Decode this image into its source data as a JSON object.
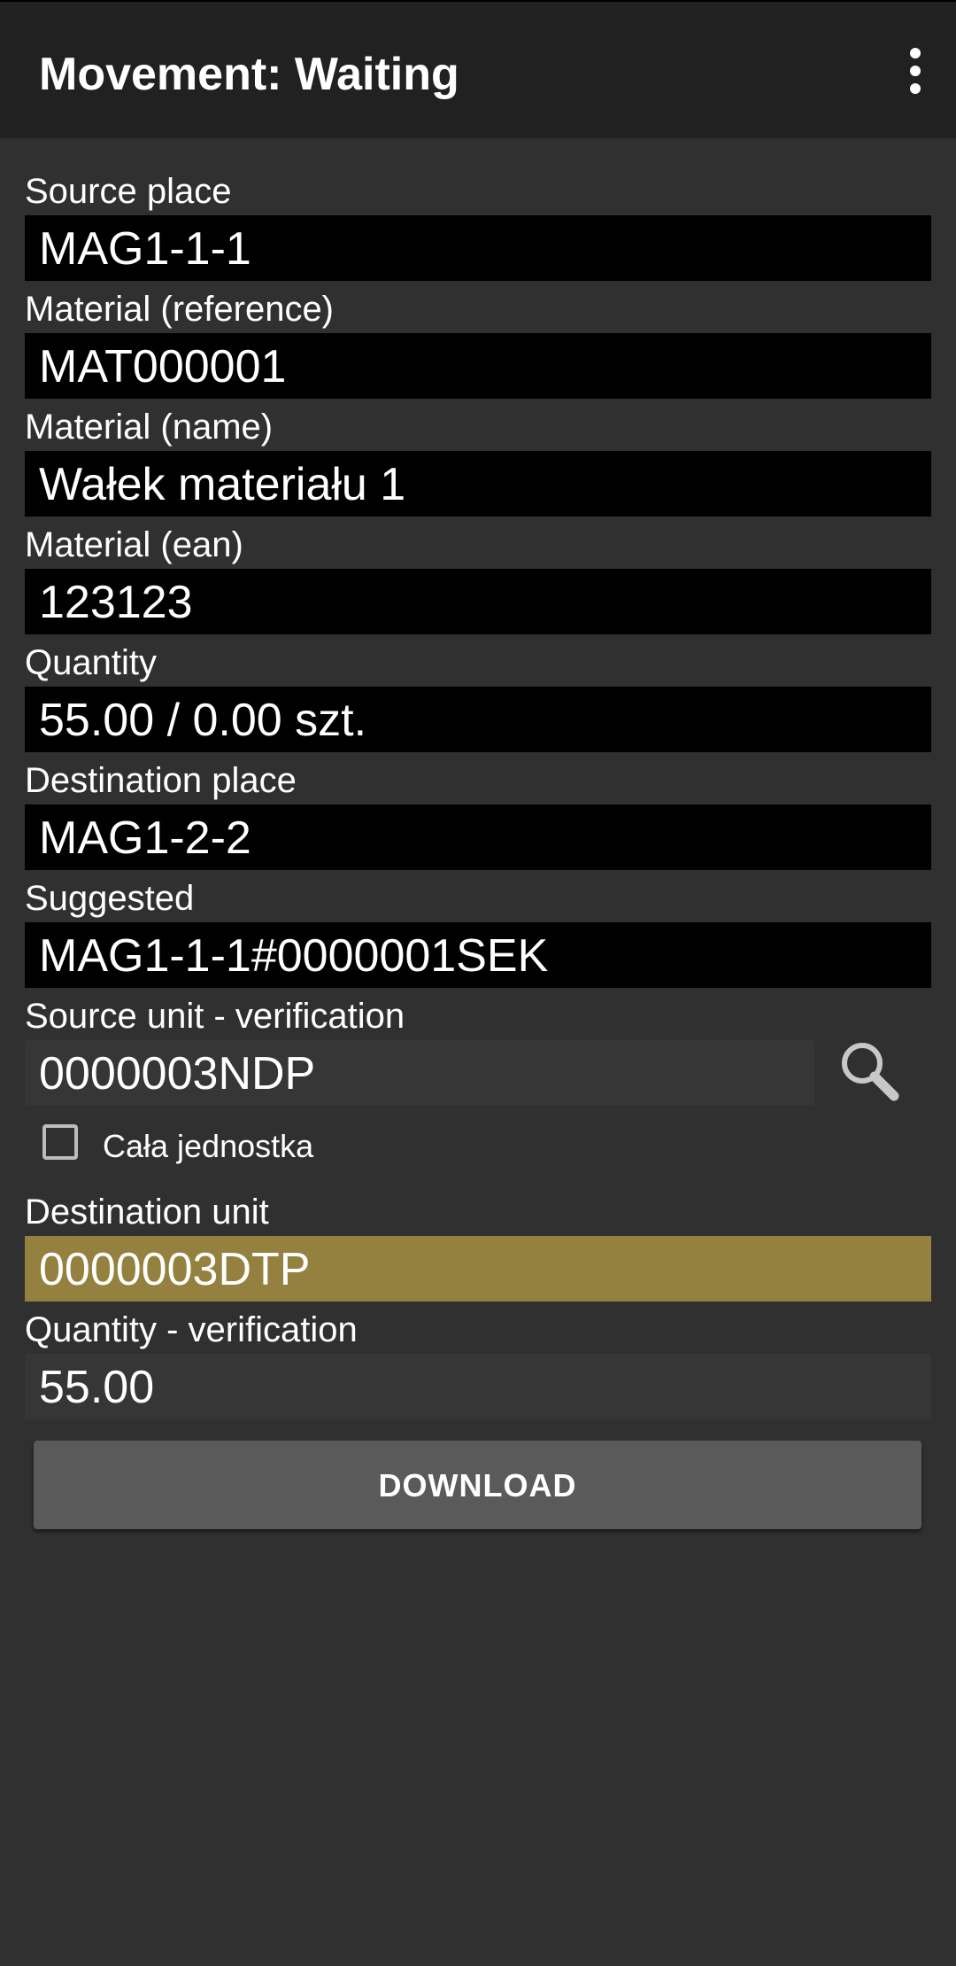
{
  "app_bar": {
    "title": "Movement: Waiting",
    "menu_icon": "more-vert-icon"
  },
  "fields": {
    "source_place": {
      "label": "Source place",
      "value": "MAG1-1-1"
    },
    "material_reference": {
      "label": "Material (reference)",
      "value": "MAT000001"
    },
    "material_name": {
      "label": "Material (name)",
      "value": "Wałek materiału 1"
    },
    "material_ean": {
      "label": "Material (ean)",
      "value": "123123"
    },
    "quantity": {
      "label": "Quantity",
      "value": "55.00 / 0.00 szt."
    },
    "destination_place": {
      "label": "Destination place",
      "value": "MAG1-2-2"
    },
    "suggested": {
      "label": "Suggested",
      "value": "MAG1-1-1#0000001SEK"
    },
    "source_unit_verification": {
      "label": "Source unit - verification",
      "value": "0000003NDP",
      "search_icon": "search-icon"
    },
    "whole_unit_checkbox": {
      "label": "Cała jednostka",
      "checked": false
    },
    "destination_unit": {
      "label": "Destination unit",
      "value": "0000003DTP"
    },
    "quantity_verification": {
      "label": "Quantity - verification",
      "value": "55.00"
    }
  },
  "actions": {
    "download_label": "DOWNLOAD"
  },
  "colors": {
    "background": "#303030",
    "app_bar": "#212121",
    "readonly_field": "#000000",
    "input_field": "#363636",
    "highlight_field": "#94813f",
    "button": "#5a5a5b"
  }
}
